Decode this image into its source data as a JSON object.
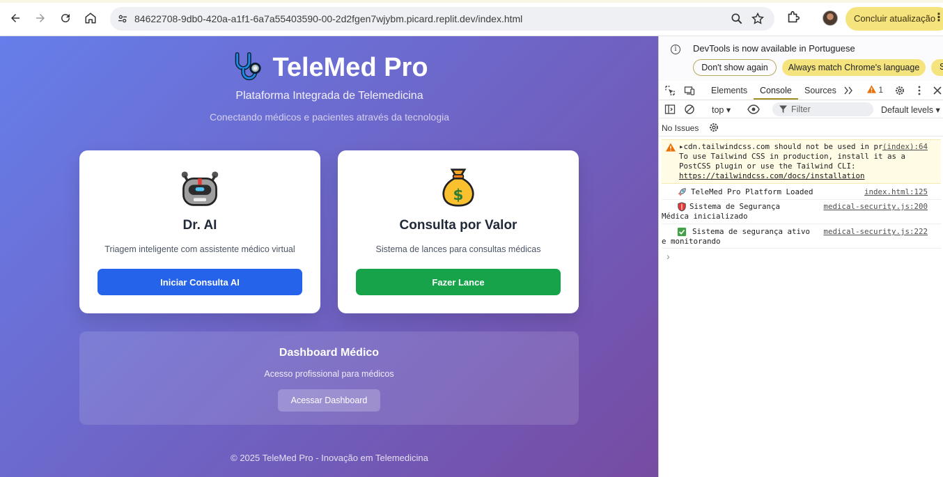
{
  "browser": {
    "url": "84622708-9db0-420a-a1f1-6a7a55403590-00-2d2fgen7wjybm.picard.replit.dev/index.html",
    "update_label": "Concluir atualização"
  },
  "page": {
    "brand_title": "TeleMed Pro",
    "subtitle": "Plataforma Integrada de Telemedicina",
    "tagline": "Conectando médicos e pacientes através da tecnologia",
    "cards": [
      {
        "title": "Dr. AI",
        "description": "Triagem inteligente com assistente médico virtual",
        "button": "Iniciar Consulta AI",
        "button_color": "#2563eb",
        "icon": "robot-icon"
      },
      {
        "title": "Consulta por Valor",
        "description": "Sistema de lances para consultas médicas",
        "button": "Fazer Lance",
        "button_color": "#16a34a",
        "icon": "money-bag-icon"
      }
    ],
    "dashboard": {
      "title": "Dashboard Médico",
      "description": "Acesso profissional para médicos",
      "button": "Acessar Dashboard"
    },
    "footer": "© 2025 TeleMed Pro - Inovação em Telemedicina",
    "gradient": [
      "#667eea",
      "#764ba2"
    ]
  },
  "devtools": {
    "infobar": {
      "message": "DevTools is now available in Portuguese",
      "dont_show": "Don't show again",
      "match_language": "Always match Chrome's language",
      "switch_label": "S"
    },
    "tabs": {
      "elements": "Elements",
      "console": "Console",
      "sources": "Sources",
      "warning_count": "1"
    },
    "console_toolbar": {
      "context": "top",
      "filter_placeholder": "Filter",
      "levels": "Default levels"
    },
    "issues_label": "No Issues",
    "messages": [
      {
        "level": "warning",
        "text": "cdn.tailwindcss.com should not be used in production. To use Tailwind CSS in production, install it as a PostCSS plugin or use the Tailwind CLI: ",
        "link": "https://tailwindcss.com/docs/installation",
        "source": "(index):64"
      },
      {
        "level": "log",
        "emoji": "rocket",
        "text": "TeleMed Pro Platform Loaded",
        "source": "index.html:125"
      },
      {
        "level": "log",
        "emoji": "shield",
        "text": "Sistema de Segurança Médica inicializado",
        "source": "medical-security.js:200"
      },
      {
        "level": "log",
        "emoji": "check",
        "text": "Sistema de segurança ativo e monitorando",
        "source": "medical-security.js:222"
      }
    ],
    "prompt": "›"
  }
}
